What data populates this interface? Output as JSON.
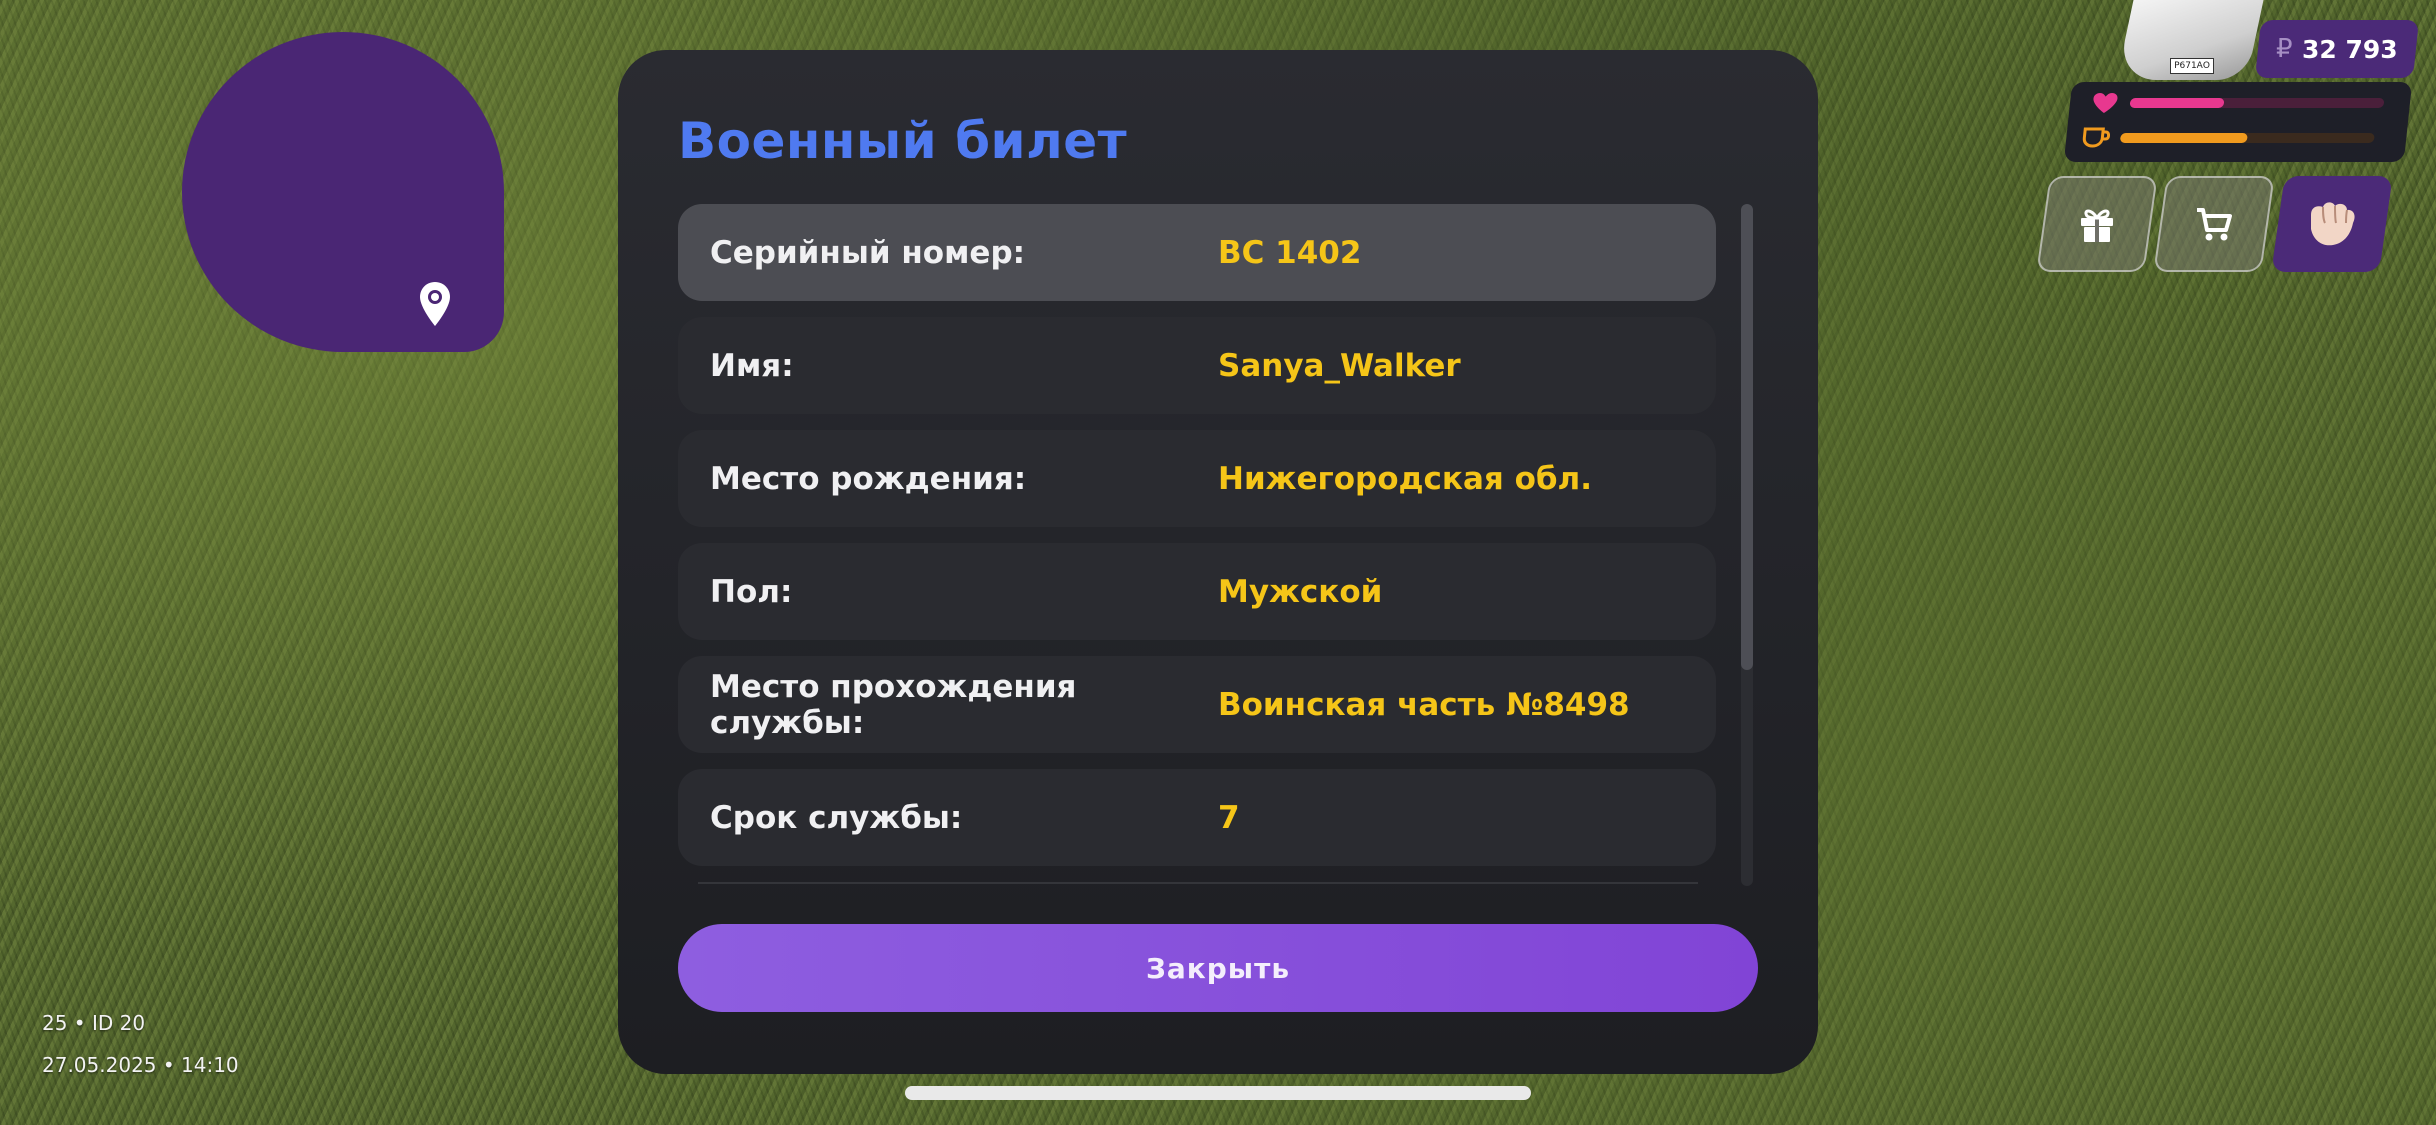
{
  "dialog": {
    "title": "Военный билет",
    "rows": [
      {
        "label": "Серийный номер:",
        "value": "BC 1402"
      },
      {
        "label": "Имя:",
        "value": "Sanya_Walker"
      },
      {
        "label": "Место рождения:",
        "value": "Нижегородская обл."
      },
      {
        "label": "Пол:",
        "value": "Мужской"
      },
      {
        "label": "Место прохождения службы:",
        "value": "Воинская часть №8498"
      },
      {
        "label": "Срок службы:",
        "value": "7"
      }
    ],
    "close_label": "Закрыть"
  },
  "hud": {
    "money": "32 793",
    "currency_icon": "ruble-icon",
    "car_plate": "Р671АО",
    "health_fraction": 0.37,
    "food_fraction": 0.5,
    "buttons": [
      "gift-icon",
      "cart-icon",
      "fist-icon"
    ]
  },
  "info": {
    "line1": "25 • ID 20",
    "line2": "27.05.2025 • 14:10"
  },
  "colors": {
    "title": "#4f7af0",
    "value": "#f5c518",
    "accent": "#8e5ee0",
    "minimap": "#4a2674"
  }
}
